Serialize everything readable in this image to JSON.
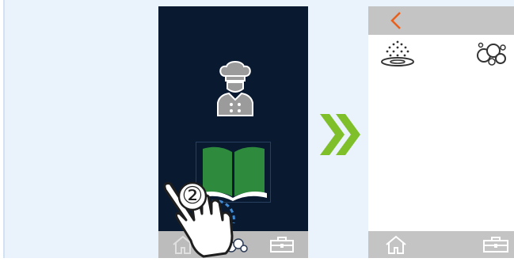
{
  "step_marker": "②",
  "colors": {
    "dark_screen": "#091930",
    "bar_gray": "#bcbcbc",
    "accent_green": "#7fbf2a",
    "book_green": "#2e8b3e",
    "back_orange": "#e8601c",
    "ring_blue": "#3f8ad3"
  },
  "icons": {
    "chef": "chef-icon",
    "book": "recipe-book-icon",
    "home": "home-icon",
    "wash": "wash-icon",
    "tools": "toolbox-icon",
    "back": "back-chevron-icon",
    "shower": "shower-icon",
    "foam": "foam-icon",
    "next": "double-chevron-right-icon"
  }
}
